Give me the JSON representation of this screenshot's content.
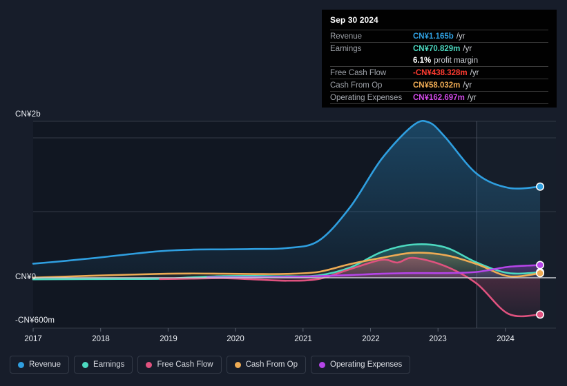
{
  "chart_data": {
    "type": "area",
    "title": "",
    "xlabel": "",
    "ylabel": "",
    "currency": "CN¥",
    "grid": true,
    "legend_position": "bottom",
    "ylim": [
      -600000000,
      2000000000
    ],
    "y_ticks": [
      {
        "label": "CN¥2b",
        "value": 2000000000
      },
      {
        "label": "CN¥0",
        "value": 0
      },
      {
        "label": "-CN¥600m",
        "value": -600000000
      }
    ],
    "x_ticks": [
      "2017",
      "2018",
      "2019",
      "2020",
      "2021",
      "2022",
      "2023",
      "2024"
    ],
    "xlim": [
      "2016-09",
      "2024-12"
    ],
    "forecast_divider_x": "2023-09",
    "series": [
      {
        "name": "Revenue",
        "color": "#2f9fe0",
        "end_value_label": "CN¥1.165b",
        "points": [
          {
            "x": "2016-09",
            "y": 180000000
          },
          {
            "x": "2017-03",
            "y": 215000000
          },
          {
            "x": "2017-09",
            "y": 255000000
          },
          {
            "x": "2018-03",
            "y": 300000000
          },
          {
            "x": "2018-09",
            "y": 340000000
          },
          {
            "x": "2019-03",
            "y": 360000000
          },
          {
            "x": "2019-09",
            "y": 363000000
          },
          {
            "x": "2020-03",
            "y": 368000000
          },
          {
            "x": "2020-09",
            "y": 380000000
          },
          {
            "x": "2021-03",
            "y": 470000000
          },
          {
            "x": "2021-09",
            "y": 900000000
          },
          {
            "x": "2022-03",
            "y": 1520000000
          },
          {
            "x": "2022-09",
            "y": 1950000000
          },
          {
            "x": "2022-12",
            "y": 1985000000
          },
          {
            "x": "2023-03",
            "y": 1800000000
          },
          {
            "x": "2023-09",
            "y": 1330000000
          },
          {
            "x": "2024-03",
            "y": 1150000000
          },
          {
            "x": "2024-09",
            "y": 1165000000
          }
        ]
      },
      {
        "name": "Earnings",
        "color": "#4cd9c0",
        "end_value_label": "CN¥70.829m",
        "points": [
          {
            "x": "2016-09",
            "y": -18000000
          },
          {
            "x": "2017-09",
            "y": -15000000
          },
          {
            "x": "2018-09",
            "y": -12000000
          },
          {
            "x": "2019-03",
            "y": 5000000
          },
          {
            "x": "2019-09",
            "y": 22000000
          },
          {
            "x": "2020-03",
            "y": 24000000
          },
          {
            "x": "2020-09",
            "y": 20000000
          },
          {
            "x": "2021-03",
            "y": 30000000
          },
          {
            "x": "2021-09",
            "y": 130000000
          },
          {
            "x": "2022-03",
            "y": 330000000
          },
          {
            "x": "2022-09",
            "y": 425000000
          },
          {
            "x": "2023-03",
            "y": 390000000
          },
          {
            "x": "2023-09",
            "y": 195000000
          },
          {
            "x": "2024-03",
            "y": 60000000
          },
          {
            "x": "2024-09",
            "y": 70829000
          }
        ]
      },
      {
        "name": "Free Cash Flow",
        "color": "#e0527f",
        "end_value_label": "-CN¥438.328m",
        "points": [
          {
            "x": "2018-09",
            "y": -15000000
          },
          {
            "x": "2019-03",
            "y": -10000000
          },
          {
            "x": "2019-09",
            "y": -5000000
          },
          {
            "x": "2020-03",
            "y": -20000000
          },
          {
            "x": "2020-09",
            "y": -35000000
          },
          {
            "x": "2021-03",
            "y": -15000000
          },
          {
            "x": "2021-09",
            "y": 110000000
          },
          {
            "x": "2022-03",
            "y": 230000000
          },
          {
            "x": "2022-06",
            "y": 195000000
          },
          {
            "x": "2022-09",
            "y": 255000000
          },
          {
            "x": "2023-03",
            "y": 150000000
          },
          {
            "x": "2023-09",
            "y": -70000000
          },
          {
            "x": "2024-03",
            "y": -430000000
          },
          {
            "x": "2024-09",
            "y": -438328000
          }
        ]
      },
      {
        "name": "Cash From Op",
        "color": "#eeab54",
        "end_value_label": "CN¥58.032m",
        "points": [
          {
            "x": "2016-09",
            "y": 2000000
          },
          {
            "x": "2017-09",
            "y": 28000000
          },
          {
            "x": "2018-09",
            "y": 50000000
          },
          {
            "x": "2019-03",
            "y": 55000000
          },
          {
            "x": "2019-09",
            "y": 52000000
          },
          {
            "x": "2020-03",
            "y": 48000000
          },
          {
            "x": "2020-09",
            "y": 50000000
          },
          {
            "x": "2021-03",
            "y": 75000000
          },
          {
            "x": "2021-09",
            "y": 175000000
          },
          {
            "x": "2022-03",
            "y": 255000000
          },
          {
            "x": "2022-09",
            "y": 320000000
          },
          {
            "x": "2023-03",
            "y": 290000000
          },
          {
            "x": "2023-09",
            "y": 175000000
          },
          {
            "x": "2024-03",
            "y": 20000000
          },
          {
            "x": "2024-09",
            "y": 58032000
          }
        ]
      },
      {
        "name": "Operating Expenses",
        "color": "#b545e8",
        "end_value_label": "CN¥162.697m",
        "points": [
          {
            "x": "2019-06",
            "y": 5000000
          },
          {
            "x": "2020-03",
            "y": 5000000
          },
          {
            "x": "2020-09",
            "y": 12000000
          },
          {
            "x": "2021-03",
            "y": 20000000
          },
          {
            "x": "2021-09",
            "y": 35000000
          },
          {
            "x": "2022-03",
            "y": 52000000
          },
          {
            "x": "2022-09",
            "y": 60000000
          },
          {
            "x": "2023-03",
            "y": 60000000
          },
          {
            "x": "2023-09",
            "y": 75000000
          },
          {
            "x": "2024-03",
            "y": 140000000
          },
          {
            "x": "2024-09",
            "y": 162697000
          }
        ]
      }
    ]
  },
  "tooltip": {
    "date": "Sep 30 2024",
    "rows": [
      {
        "key": "Revenue",
        "value": "CN¥1.165b",
        "unit": "/yr",
        "color": "#2f9fe0"
      },
      {
        "key": "Earnings",
        "value": "CN¥70.829m",
        "unit": "/yr",
        "color": "#4cd9c0"
      },
      {
        "key": "",
        "value": "6.1%",
        "unit": "profit margin",
        "color": "#ffffff"
      },
      {
        "key": "Free Cash Flow",
        "value": "-CN¥438.328m",
        "unit": "/yr",
        "color": "#ff3b30"
      },
      {
        "key": "Cash From Op",
        "value": "CN¥58.032m",
        "unit": "/yr",
        "color": "#eeab54"
      },
      {
        "key": "Operating Expenses",
        "value": "CN¥162.697m",
        "unit": "/yr",
        "color": "#d24ae8"
      }
    ]
  },
  "legend": [
    {
      "label": "Revenue",
      "color": "#2f9fe0"
    },
    {
      "label": "Earnings",
      "color": "#4cd9c0"
    },
    {
      "label": "Free Cash Flow",
      "color": "#e0527f"
    },
    {
      "label": "Cash From Op",
      "color": "#eeab54"
    },
    {
      "label": "Operating Expenses",
      "color": "#b545e8"
    }
  ],
  "axis": {
    "y_labels": [
      "CN¥2b",
      "CN¥0",
      "-CN¥600m"
    ],
    "x_labels": [
      "2017",
      "2018",
      "2019",
      "2020",
      "2021",
      "2022",
      "2023",
      "2024"
    ]
  }
}
